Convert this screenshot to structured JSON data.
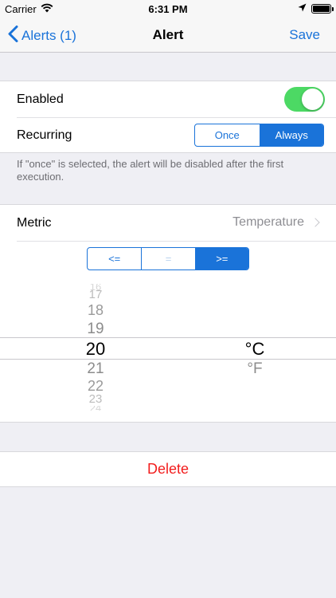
{
  "status_bar": {
    "carrier": "Carrier",
    "time": "6:31 PM",
    "icons": [
      "wifi-icon",
      "location-arrow-icon",
      "battery-icon"
    ]
  },
  "nav": {
    "back_label": "Alerts (1)",
    "title": "Alert",
    "save_label": "Save"
  },
  "settings": {
    "enabled_label": "Enabled",
    "enabled_value": true,
    "recurring_label": "Recurring",
    "recurring_options": [
      "Once",
      "Always"
    ],
    "recurring_selected": "Always",
    "footnote": "If \"once\" is selected, the alert will be disabled after the first execution."
  },
  "metric": {
    "label": "Metric",
    "value": "Temperature",
    "comparators": [
      "<=",
      "=",
      ">="
    ],
    "comparator_selected": ">="
  },
  "picker": {
    "numbers": [
      "16",
      "17",
      "18",
      "19",
      "20",
      "21",
      "22",
      "23",
      "24"
    ],
    "selected_number": "20",
    "units": [
      "°C",
      "°F"
    ],
    "selected_unit": "°C"
  },
  "delete_label": "Delete",
  "colors": {
    "accent": "#1a73d9",
    "toggle_on": "#4cd964",
    "destructive": "#f21d1d",
    "background": "#efeff4"
  }
}
